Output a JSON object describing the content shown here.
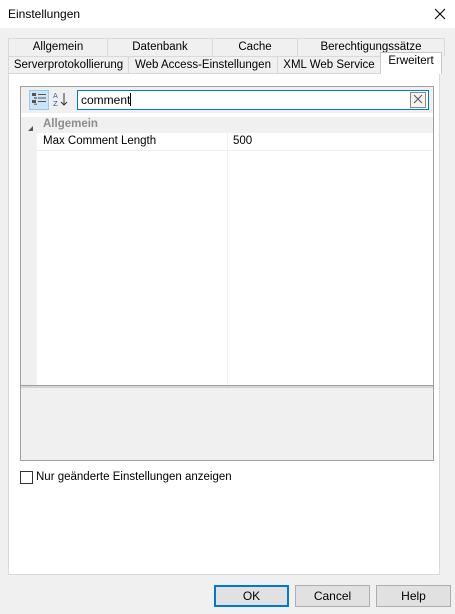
{
  "window": {
    "title": "Einstellungen"
  },
  "tabs": {
    "row1": [
      "Allgemein",
      "Datenbank",
      "Cache",
      "Berechtigungssätze"
    ],
    "row2": [
      "Serverprotokollierung",
      "Web Access-Einstellungen",
      "XML Web Service",
      "Erweitert"
    ],
    "active": "Erweitert"
  },
  "search": {
    "value": "comment"
  },
  "property_grid": {
    "category": "Allgemein",
    "rows": [
      {
        "name": "Max Comment Length",
        "value": "500"
      }
    ]
  },
  "checkbox": {
    "label": "Nur geänderte Einstellungen anzeigen",
    "checked": false
  },
  "buttons": {
    "ok": "OK",
    "cancel": "Cancel",
    "help": "Help"
  }
}
